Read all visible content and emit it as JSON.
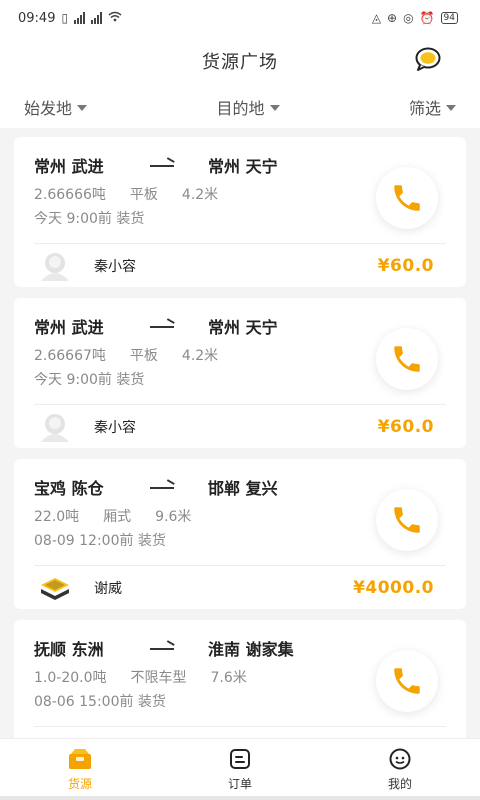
{
  "status_bar": {
    "time": "09:49",
    "battery": "94"
  },
  "header": {
    "title": "货源广场"
  },
  "filters": [
    {
      "label": "始发地"
    },
    {
      "label": "目的地"
    },
    {
      "label": "筛选"
    }
  ],
  "cargo": [
    {
      "from": "常州 武进",
      "to": "常州 天宁",
      "weight": "2.66666吨",
      "truck_type": "平板",
      "length": "4.2米",
      "load_time": "今天 9:00前 装货",
      "owner": "秦小容",
      "price": "¥60.0",
      "avatar": "person-avatar-icon"
    },
    {
      "from": "常州 武进",
      "to": "常州 天宁",
      "weight": "2.66667吨",
      "truck_type": "平板",
      "length": "4.2米",
      "load_time": "今天 9:00前 装货",
      "owner": "秦小容",
      "price": "¥60.0",
      "avatar": "person-avatar-icon"
    },
    {
      "from": "宝鸡 陈仓",
      "to": "邯郸 复兴",
      "weight": "22.0吨",
      "truck_type": "厢式",
      "length": "9.6米",
      "load_time": "08-09 12:00前 装货",
      "owner": "谢威",
      "price": "¥4000.0",
      "avatar": "company-logo-icon"
    },
    {
      "from": "抚顺 东洲",
      "to": "淮南 谢家集",
      "weight": "1.0-20.0吨",
      "truck_type": "不限车型",
      "length": "7.6米",
      "load_time": "08-06 15:00前 装货",
      "owner": "",
      "price": "",
      "avatar": "company-logo-icon"
    }
  ],
  "bottom_nav": [
    {
      "label": "货源",
      "icon": "cargo-box-icon",
      "active": true
    },
    {
      "label": "订单",
      "icon": "order-list-icon",
      "active": false
    },
    {
      "label": "我的",
      "icon": "profile-face-icon",
      "active": false
    }
  ],
  "colors": {
    "accent": "#f5a300",
    "background": "#f4f4f4"
  }
}
